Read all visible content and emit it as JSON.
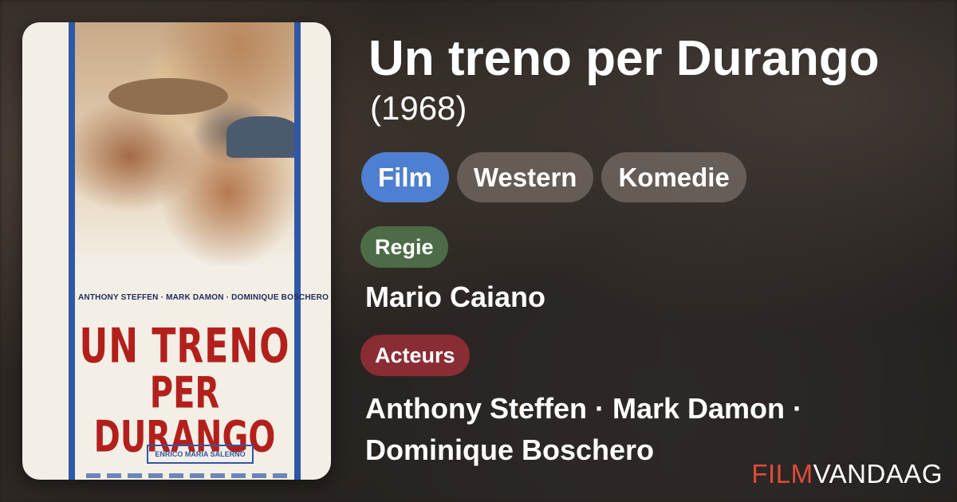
{
  "movie": {
    "title": "Un treno per Durango",
    "year": "(1968)"
  },
  "tags": [
    {
      "label": "Film"
    },
    {
      "label": "Western"
    },
    {
      "label": "Komedie"
    }
  ],
  "sections": {
    "director_label": "Regie",
    "director": "Mario Caiano",
    "actors_label": "Acteurs",
    "actors_line1": "Anthony Steffen · Mark Damon ·",
    "actors_line2": "Dominique Boschero"
  },
  "poster": {
    "cast_line": "ANTHONY STEFFEN · MARK DAMON · DOMINIQUE BOSCHERO",
    "title_line1": "UN TRENO",
    "title_line2": "PER DURANGO",
    "credit_box": "ENRICO MARIA SALERNO"
  },
  "brand": {
    "part1": "FILM",
    "part2": "VANDAAG"
  },
  "colors": {
    "tag_primary": "#4f7fd0",
    "badge_regie": "#4d6b46",
    "badge_acteurs": "#8a2c34",
    "brand_accent": "#e24a3b"
  }
}
